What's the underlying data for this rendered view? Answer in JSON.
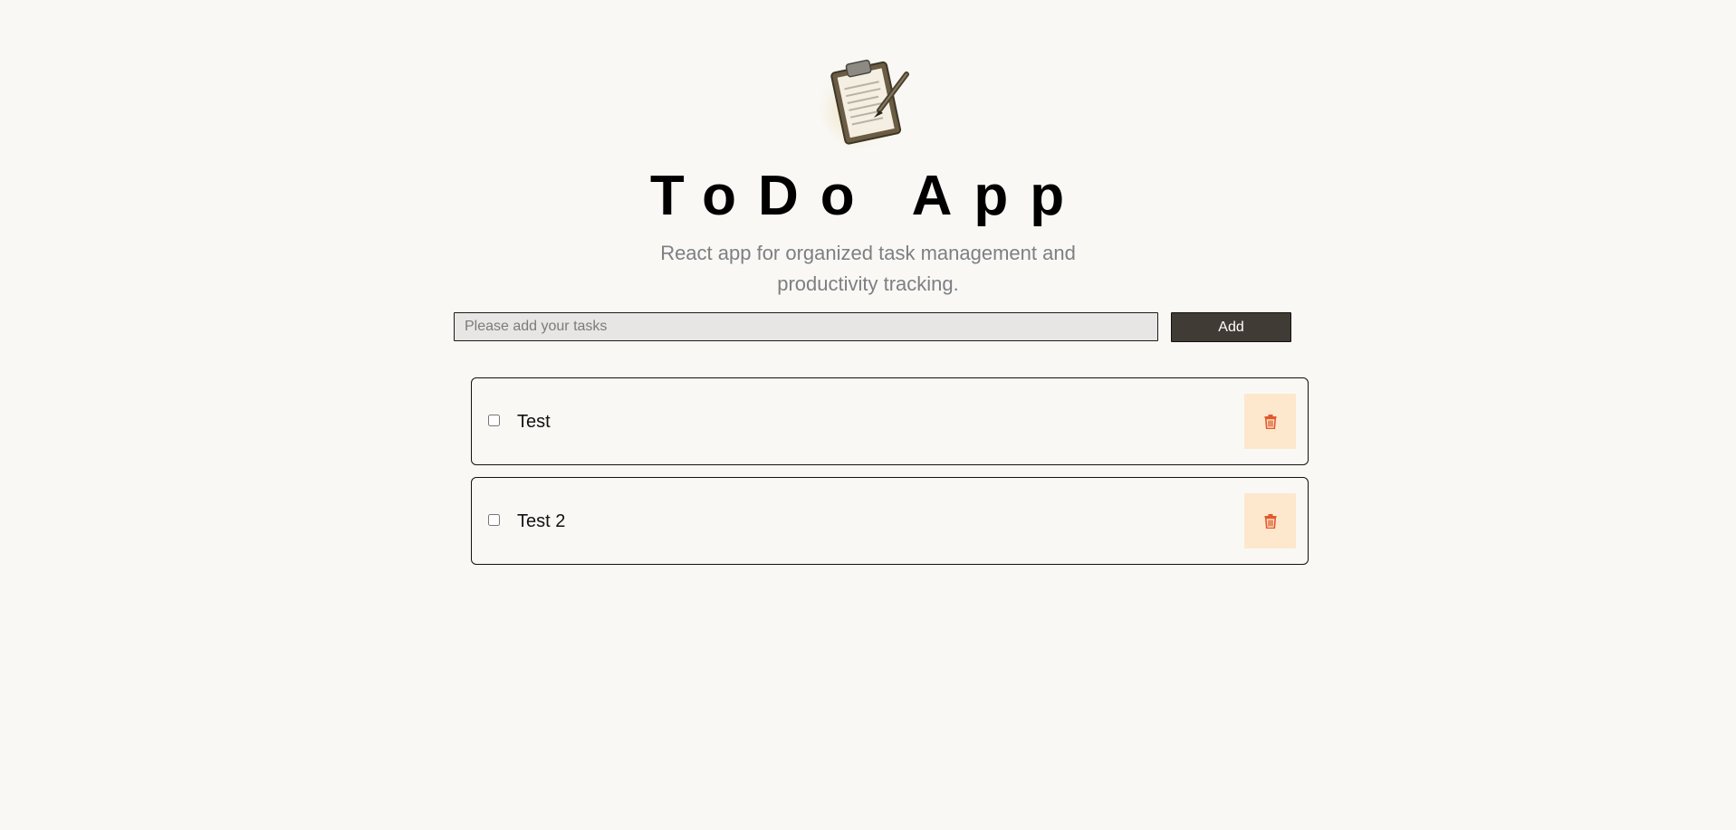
{
  "app": {
    "title": "ToDo App",
    "subtitle_line1": "React app for organized task management and",
    "subtitle_line2": "productivity tracking.",
    "logo_icon": "clipboard-with-pen-icon"
  },
  "form": {
    "input_value": "",
    "input_placeholder": "Please add your tasks",
    "add_label": "Add"
  },
  "todos": [
    {
      "label": "Test",
      "checked": false,
      "delete_icon": "trash-icon"
    },
    {
      "label": "Test 2",
      "checked": false,
      "delete_icon": "trash-icon"
    }
  ],
  "colors": {
    "background": "#f9f8f5",
    "button": "#403c35",
    "delete_bg": "#fde8cd",
    "delete_icon": "#e05a2b",
    "subtitle": "#7d7f83"
  }
}
